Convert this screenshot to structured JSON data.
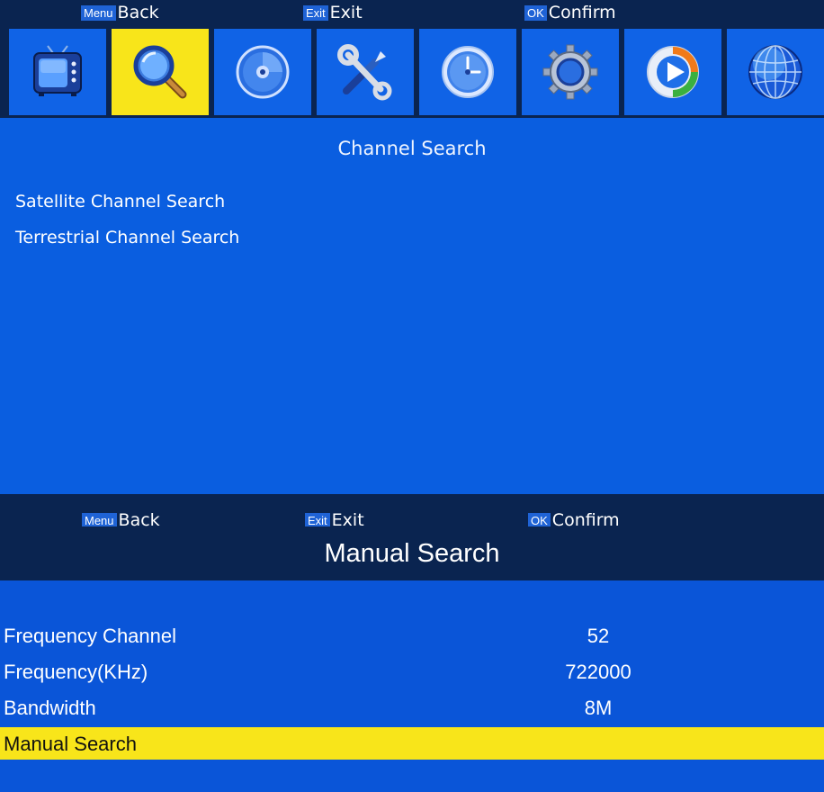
{
  "top_screen": {
    "hints": [
      {
        "key": "Menu",
        "label": "Back"
      },
      {
        "key": "Exit",
        "label": "Exit"
      },
      {
        "key": "OK",
        "label": "Confirm"
      }
    ],
    "icons": [
      {
        "name": "tv-icon",
        "selected": false
      },
      {
        "name": "search-icon",
        "selected": true
      },
      {
        "name": "disc-icon",
        "selected": false
      },
      {
        "name": "tools-icon",
        "selected": false
      },
      {
        "name": "clock-icon",
        "selected": false
      },
      {
        "name": "gear-icon",
        "selected": false
      },
      {
        "name": "media-play-icon",
        "selected": false
      },
      {
        "name": "globe-icon",
        "selected": false
      }
    ],
    "title": "Channel Search",
    "menu_items": [
      "Satellite Channel Search",
      "Terrestrial Channel Search"
    ]
  },
  "bottom_screen": {
    "hints": [
      {
        "key": "Menu",
        "label": "Back"
      },
      {
        "key": "Exit",
        "label": "Exit"
      },
      {
        "key": "OK",
        "label": "Confirm"
      }
    ],
    "title": "Manual Search",
    "rows": [
      {
        "label": "Frequency Channel",
        "value": "52"
      },
      {
        "label": "Frequency(KHz)",
        "value": "722000"
      },
      {
        "label": "Bandwidth",
        "value": "8M"
      },
      {
        "label": "Manual Search",
        "value": ""
      }
    ],
    "selected_row": 3
  },
  "colors": {
    "background_blue": "#0a55d8",
    "dark_bar": "#0a2450",
    "highlight_yellow": "#f8e51a"
  }
}
